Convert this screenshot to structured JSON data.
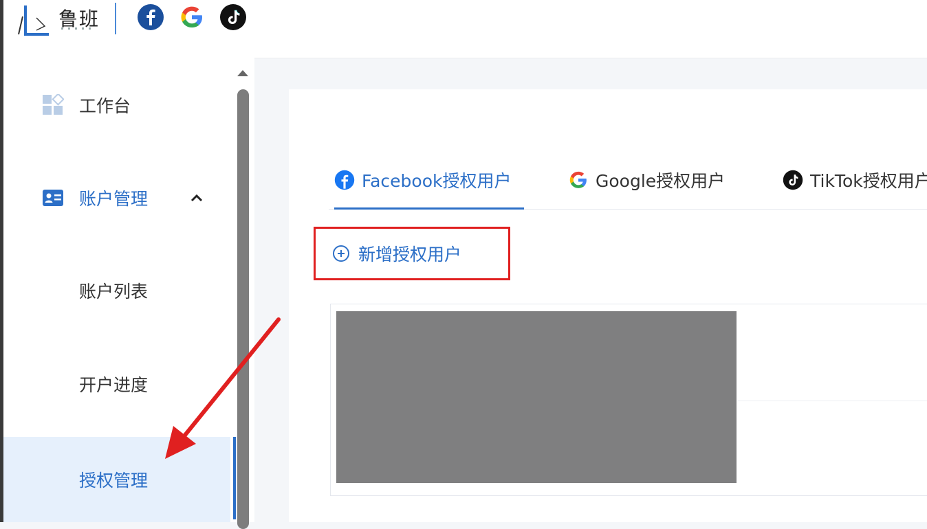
{
  "brand": {
    "logo_text": "鲁班"
  },
  "social_icons": [
    "facebook-icon",
    "google-icon",
    "tiktok-icon"
  ],
  "sidebar": {
    "items": [
      {
        "label": "工作台",
        "icon": "dashboard-icon"
      },
      {
        "label": "账户管理",
        "icon": "id-card-icon",
        "expanded": true
      },
      {
        "label": "账户列表"
      },
      {
        "label": "开户进度"
      },
      {
        "label": "授权管理",
        "active": true
      }
    ]
  },
  "tabs": [
    {
      "label": "Facebook授权用户",
      "icon": "facebook-icon",
      "active": true
    },
    {
      "label": "Google授权用户",
      "icon": "google-icon"
    },
    {
      "label": "TikTok授权用户",
      "icon": "tiktok-icon"
    }
  ],
  "actions": {
    "add_label": "新增授权用户"
  },
  "colors": {
    "accent": "#2c6fc7",
    "highlight_border": "#e02020",
    "arrow": "#e02020",
    "active_bg": "#e6f0fc",
    "redacted": "#7f7f80"
  }
}
